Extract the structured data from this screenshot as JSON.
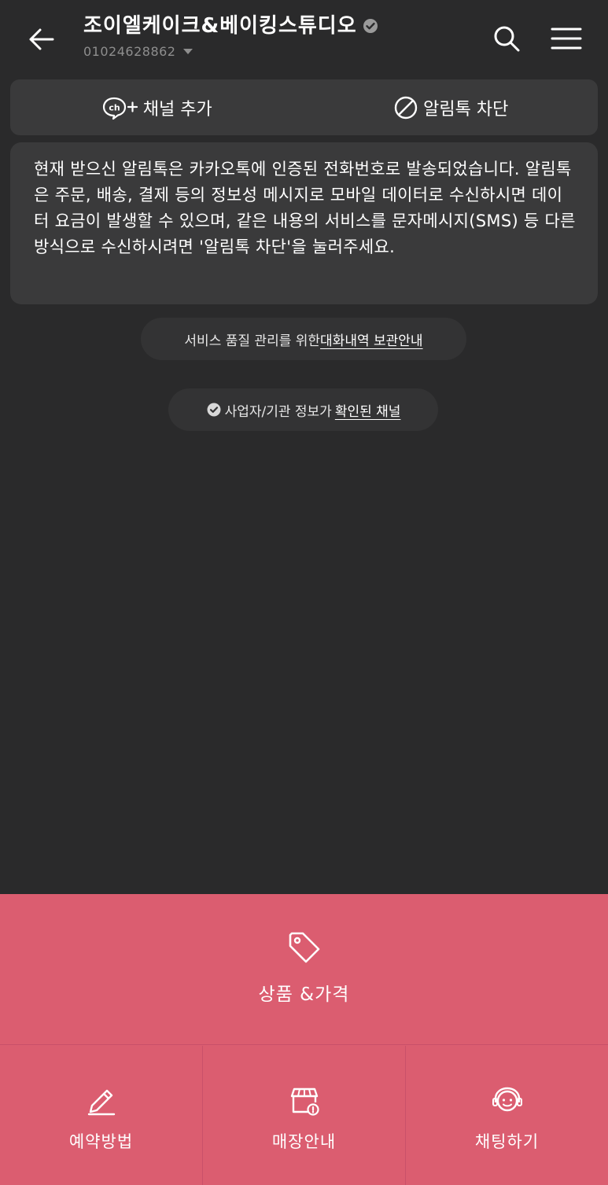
{
  "header": {
    "title": "조이엘케이크&베이킹스튜디오",
    "phone": "01024628862"
  },
  "actions": {
    "add_channel": "채널 추가",
    "block_alimtalk": "알림톡 차단"
  },
  "notice": {
    "text": "현재 받으신 알림톡은 카카오톡에 인증된 전화번호로 발송되었습니다. 알림톡은 주문, 배송, 결제 등의 정보성 메시지로 모바일 데이터로 수신하시면 데이터 요금이 발생할 수 있으며, 같은 내용의 서비스를 문자메시지(SMS) 등 다른 방식으로 수신하시려면 '알림톡 차단'을 눌러주세요."
  },
  "info": {
    "storage_prefix": "서비스 품질 관리를 위한 ",
    "storage_link": "대화내역 보관안내",
    "verified_prefix": "사업자/기관 정보가 ",
    "verified_link": "확인된 채널"
  },
  "bottom_menu": {
    "main_label": "상품 &가격",
    "items": [
      {
        "label": "예약방법",
        "icon": "pencil-icon"
      },
      {
        "label": "매장안내",
        "icon": "store-icon"
      },
      {
        "label": "채팅하기",
        "icon": "chat-agent-icon"
      }
    ]
  },
  "colors": {
    "background": "#2a2a2b",
    "card": "#3a3a3b",
    "menu": "#db5d70"
  }
}
